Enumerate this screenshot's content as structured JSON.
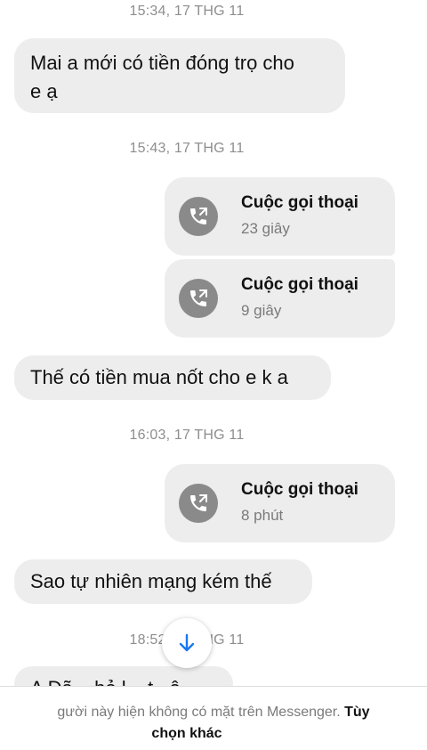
{
  "conversation": {
    "timestamps": [
      "15:34, 17 THG 11",
      "15:43, 17 THG 11",
      "16:03, 17 THG 11",
      "18:52, 17 THG 11"
    ],
    "messages": [
      {
        "line1": "Mai a mới có tiền đóng trọ cho",
        "line2": "e ạ"
      },
      {
        "text": "Thế có tiền mua nốt cho e k a"
      },
      {
        "text": "Sao tự nhiên mạng kém thế"
      },
      {
        "text": "A Đã... bỏ l... t...ê"
      }
    ],
    "calls": [
      {
        "title": "Cuộc gọi thoại",
        "duration": "23 giây"
      },
      {
        "title": "Cuộc gọi thoại",
        "duration": "9 giây"
      },
      {
        "title": "Cuộc gọi thoại",
        "duration": "8 phút"
      }
    ]
  },
  "footer": {
    "notice": "gười này hiện không có mặt trên Messenger.",
    "link_part1": "Tùy",
    "link_part2": "chọn khác"
  },
  "icons": {
    "call": "phone-call-icon",
    "scroll": "arrow-down-icon"
  },
  "colors": {
    "bubble": "#ededed",
    "call_icon": "#8a8a8a",
    "scroll_arrow": "#1877f2",
    "muted_text": "#8e8e8e"
  }
}
